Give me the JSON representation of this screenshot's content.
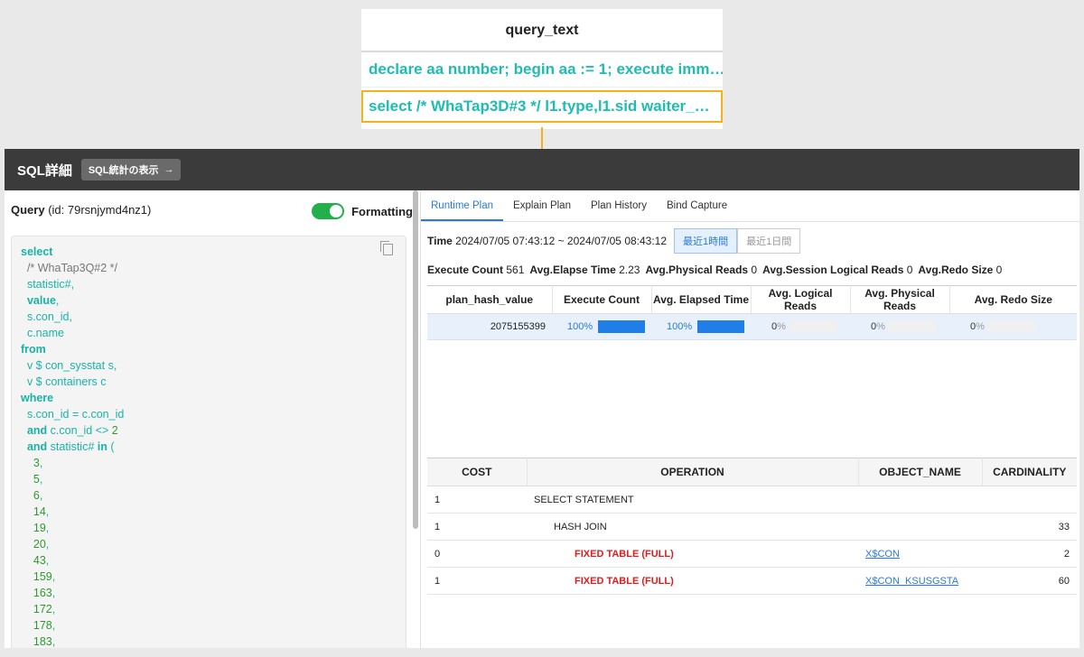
{
  "popup": {
    "header": "query_text",
    "rows": [
      "declare aa number; begin aa := 1; execute imm…",
      "select /* WhaTap3D#3 */ l1.type,l1.sid waiter_…"
    ]
  },
  "header": {
    "title": "SQL詳細",
    "stats_button": "SQL統計の表示"
  },
  "query": {
    "label": "Query",
    "id_text": "(id: 79rsnjymd4nz1)",
    "formatting_label": "Formatting"
  },
  "code": {
    "lines": [
      [
        {
          "t": "select",
          "c": "kw"
        }
      ],
      [
        {
          "t": "  /* WhaTap3Q#2 */",
          "c": "cm"
        }
      ],
      [
        {
          "t": "  statistic#",
          "c": "tx"
        },
        {
          "t": ",",
          "c": "tx"
        }
      ],
      [
        {
          "t": "  ",
          "c": "tx"
        },
        {
          "t": "value",
          "c": "kw"
        },
        {
          "t": ",",
          "c": "tx"
        }
      ],
      [
        {
          "t": "  s.con_id",
          "c": "tx"
        },
        {
          "t": ",",
          "c": "tx"
        }
      ],
      [
        {
          "t": "  c.name",
          "c": "tx"
        }
      ],
      [
        {
          "t": "from",
          "c": "kw"
        }
      ],
      [
        {
          "t": "  v $ con_sysstat s",
          "c": "tx"
        },
        {
          "t": ",",
          "c": "tx"
        }
      ],
      [
        {
          "t": "  v $ containers c",
          "c": "tx"
        }
      ],
      [
        {
          "t": "where",
          "c": "kw"
        }
      ],
      [
        {
          "t": "  s.con_id = c.con_id",
          "c": "tx"
        }
      ],
      [
        {
          "t": "  ",
          "c": "tx"
        },
        {
          "t": "and",
          "c": "kw"
        },
        {
          "t": " c.con_id <> ",
          "c": "tx"
        },
        {
          "t": "2",
          "c": "nm"
        }
      ],
      [
        {
          "t": "  ",
          "c": "tx"
        },
        {
          "t": "and",
          "c": "kw"
        },
        {
          "t": " statistic# ",
          "c": "tx"
        },
        {
          "t": "in",
          "c": "kw"
        },
        {
          "t": " (",
          "c": "tx"
        }
      ],
      [
        {
          "t": "    3",
          "c": "nm"
        },
        {
          "t": ",",
          "c": "tx"
        }
      ],
      [
        {
          "t": "    5",
          "c": "nm"
        },
        {
          "t": ",",
          "c": "tx"
        }
      ],
      [
        {
          "t": "    6",
          "c": "nm"
        },
        {
          "t": ",",
          "c": "tx"
        }
      ],
      [
        {
          "t": "    14",
          "c": "nm"
        },
        {
          "t": ",",
          "c": "tx"
        }
      ],
      [
        {
          "t": "    19",
          "c": "nm"
        },
        {
          "t": ",",
          "c": "tx"
        }
      ],
      [
        {
          "t": "    20",
          "c": "nm"
        },
        {
          "t": ",",
          "c": "tx"
        }
      ],
      [
        {
          "t": "    43",
          "c": "nm"
        },
        {
          "t": ",",
          "c": "tx"
        }
      ],
      [
        {
          "t": "    159",
          "c": "nm"
        },
        {
          "t": ",",
          "c": "tx"
        }
      ],
      [
        {
          "t": "    163",
          "c": "nm"
        },
        {
          "t": ",",
          "c": "tx"
        }
      ],
      [
        {
          "t": "    172",
          "c": "nm"
        },
        {
          "t": ",",
          "c": "tx"
        }
      ],
      [
        {
          "t": "    178",
          "c": "nm"
        },
        {
          "t": ",",
          "c": "tx"
        }
      ],
      [
        {
          "t": "    183",
          "c": "nm"
        },
        {
          "t": ",",
          "c": "tx"
        }
      ]
    ]
  },
  "tabs": [
    "Runtime Plan",
    "Explain Plan",
    "Plan History",
    "Bind Capture"
  ],
  "time": {
    "label": "Time",
    "value": "2024/07/05 07:43:12 ~ 2024/07/05 08:43:12",
    "range_active": "最近1時間",
    "range_inactive": "最近1日間"
  },
  "stats": [
    {
      "label": "Execute Count",
      "value": "561"
    },
    {
      "label": "Avg.Elapse Time",
      "value": "2.23"
    },
    {
      "label": "Avg.Physical Reads",
      "value": "0"
    },
    {
      "label": "Avg.Session Logical Reads",
      "value": "0"
    },
    {
      "label": "Avg.Redo Size",
      "value": "0"
    }
  ],
  "plan_table": {
    "headers": [
      "plan_hash_value",
      "Execute Count",
      "Avg. Elapsed Time",
      "Avg. Logical Reads",
      "Avg. Physical Reads",
      "Avg. Redo Size"
    ],
    "row": {
      "plan_hash_value": "2075155399",
      "cells": [
        {
          "pct": "100",
          "fraction": 1.0
        },
        {
          "pct": "100",
          "fraction": 1.0
        },
        {
          "pct": "0",
          "fraction": 0
        },
        {
          "pct": "0",
          "fraction": 0
        },
        {
          "pct": "0",
          "fraction": 0
        }
      ]
    }
  },
  "ops_table": {
    "headers": [
      "COST",
      "OPERATION",
      "OBJECT_NAME",
      "CARDINALITY"
    ],
    "rows": [
      {
        "cost": "1",
        "operation": "SELECT STATEMENT",
        "depth": 0,
        "fixed": false,
        "object": "",
        "cardinality": ""
      },
      {
        "cost": "1",
        "operation": "HASH JOIN",
        "depth": 1,
        "fixed": false,
        "object": "",
        "cardinality": "33"
      },
      {
        "cost": "0",
        "operation": "FIXED TABLE (FULL)",
        "depth": 2,
        "fixed": true,
        "object": "X$CON",
        "cardinality": "2"
      },
      {
        "cost": "1",
        "operation": "FIXED TABLE (FULL)",
        "depth": 2,
        "fixed": true,
        "object": "X$CON_KSUSGSTA",
        "cardinality": "60"
      }
    ]
  },
  "colors": {
    "accent": "#2a7ad8",
    "highlight": "#f2b21b",
    "keyword": "#19b3a6",
    "toggle_on": "#22b04a",
    "fixed_op": "#e01b1b"
  }
}
